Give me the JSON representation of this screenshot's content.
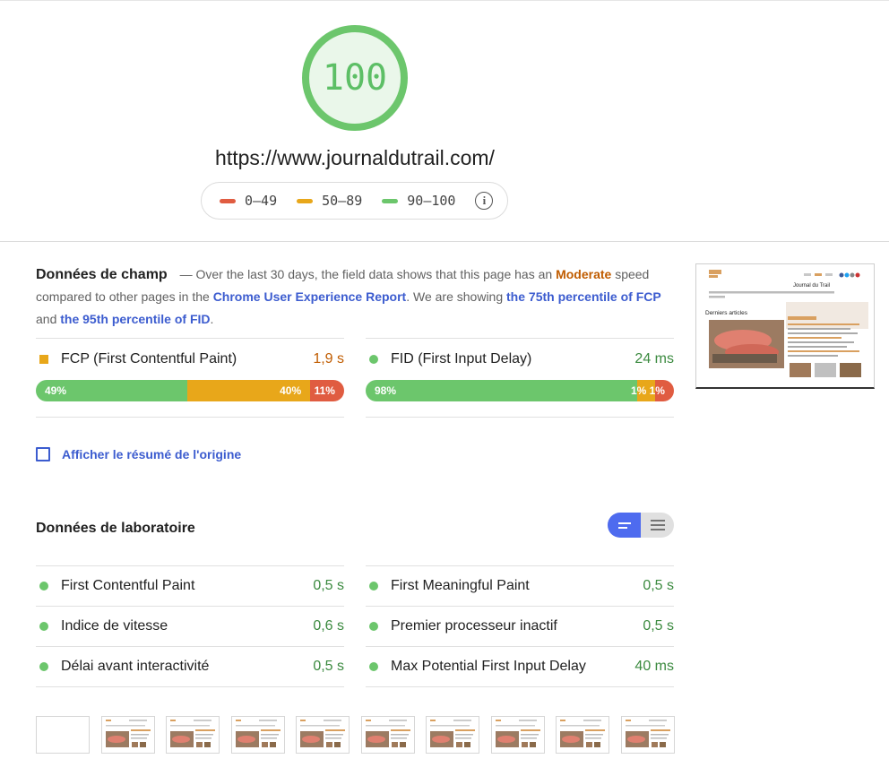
{
  "score": {
    "value": "100",
    "color": "#5dbf66"
  },
  "url": "https://www.journaldutrail.com/",
  "legend": {
    "items": [
      {
        "label": "0–49",
        "color": "#e05c41"
      },
      {
        "label": "50–89",
        "color": "#e8a71a"
      },
      {
        "label": "90–100",
        "color": "#6cc66c"
      }
    ],
    "info_icon": "info-icon"
  },
  "field": {
    "heading": "Données de champ",
    "dash": "—",
    "text1": "Over the last 30 days, the field data shows that this page has an",
    "moderate": "Moderate",
    "text2": "speed compared to other pages in the",
    "cruxLink": "Chrome User Experience Report",
    "text3": ". We are showing",
    "fcpLink": "the 75th percentile of FCP",
    "text4": "and",
    "fidLink": "the 95th percentile of FID",
    "text5": ".",
    "metrics": [
      {
        "label": "FCP (First Contentful Paint)",
        "value": "1,9 s",
        "valueColor": "#c05c00",
        "marker": "square",
        "markerColor": "#e8a71a",
        "dist": [
          {
            "pct": "49%",
            "frac": 0.49,
            "color": "#6cc66c"
          },
          {
            "pct": "40%",
            "frac": 0.4,
            "color": "#e8a71a"
          },
          {
            "pct": "11%",
            "frac": 0.11,
            "color": "#e05c41"
          }
        ]
      },
      {
        "label": "FID (First Input Delay)",
        "value": "24 ms",
        "valueColor": "#3b8a3f",
        "marker": "circle",
        "markerColor": "#6cc66c",
        "dist": [
          {
            "pct": "98%",
            "frac": 0.88,
            "color": "#6cc66c"
          },
          {
            "pct": "1%",
            "frac": 0.06,
            "color": "#e8a71a"
          },
          {
            "pct": "1%",
            "frac": 0.06,
            "color": "#e05c41"
          }
        ]
      }
    ]
  },
  "origin": {
    "label": "Afficher le résumé de l'origine"
  },
  "lab": {
    "heading": "Données de laboratoire",
    "left": [
      {
        "label": "First Contentful Paint",
        "value": "0,5 s"
      },
      {
        "label": "Indice de vitesse",
        "value": "0,6 s"
      },
      {
        "label": "Délai avant interactivité",
        "value": "0,5 s"
      }
    ],
    "right": [
      {
        "label": "First Meaningful Paint",
        "value": "0,5 s"
      },
      {
        "label": "Premier processeur inactif",
        "value": "0,5 s"
      },
      {
        "label": "Max Potential First Input Delay",
        "value": "40 ms"
      }
    ]
  },
  "screenshot": {
    "site_title": "Journal du Trail",
    "section": "Derniers articles"
  },
  "filmstrip_count": 10
}
